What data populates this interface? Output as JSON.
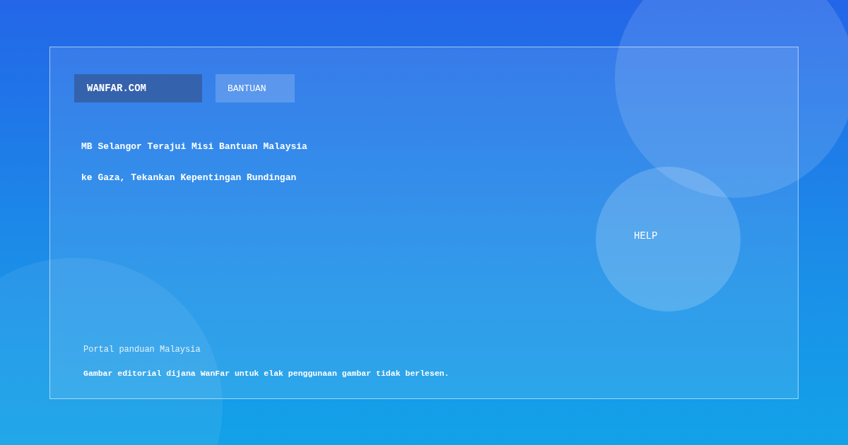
{
  "nav": [
    {
      "label": "WANFAR.COM",
      "kind": "brand"
    },
    {
      "label": "BANTUAN",
      "kind": "link"
    }
  ],
  "headline": [
    "MB Selangor Terajui Misi Bantuan Malaysia",
    "ke Gaza, Tekankan Kepentingan Rundingan"
  ],
  "help_button": "HELP",
  "tagline": "Portal panduan Malaysia",
  "disclaimer": "Gambar editorial dijana WanFar untuk elak penggunaan gambar tidak berlesen."
}
